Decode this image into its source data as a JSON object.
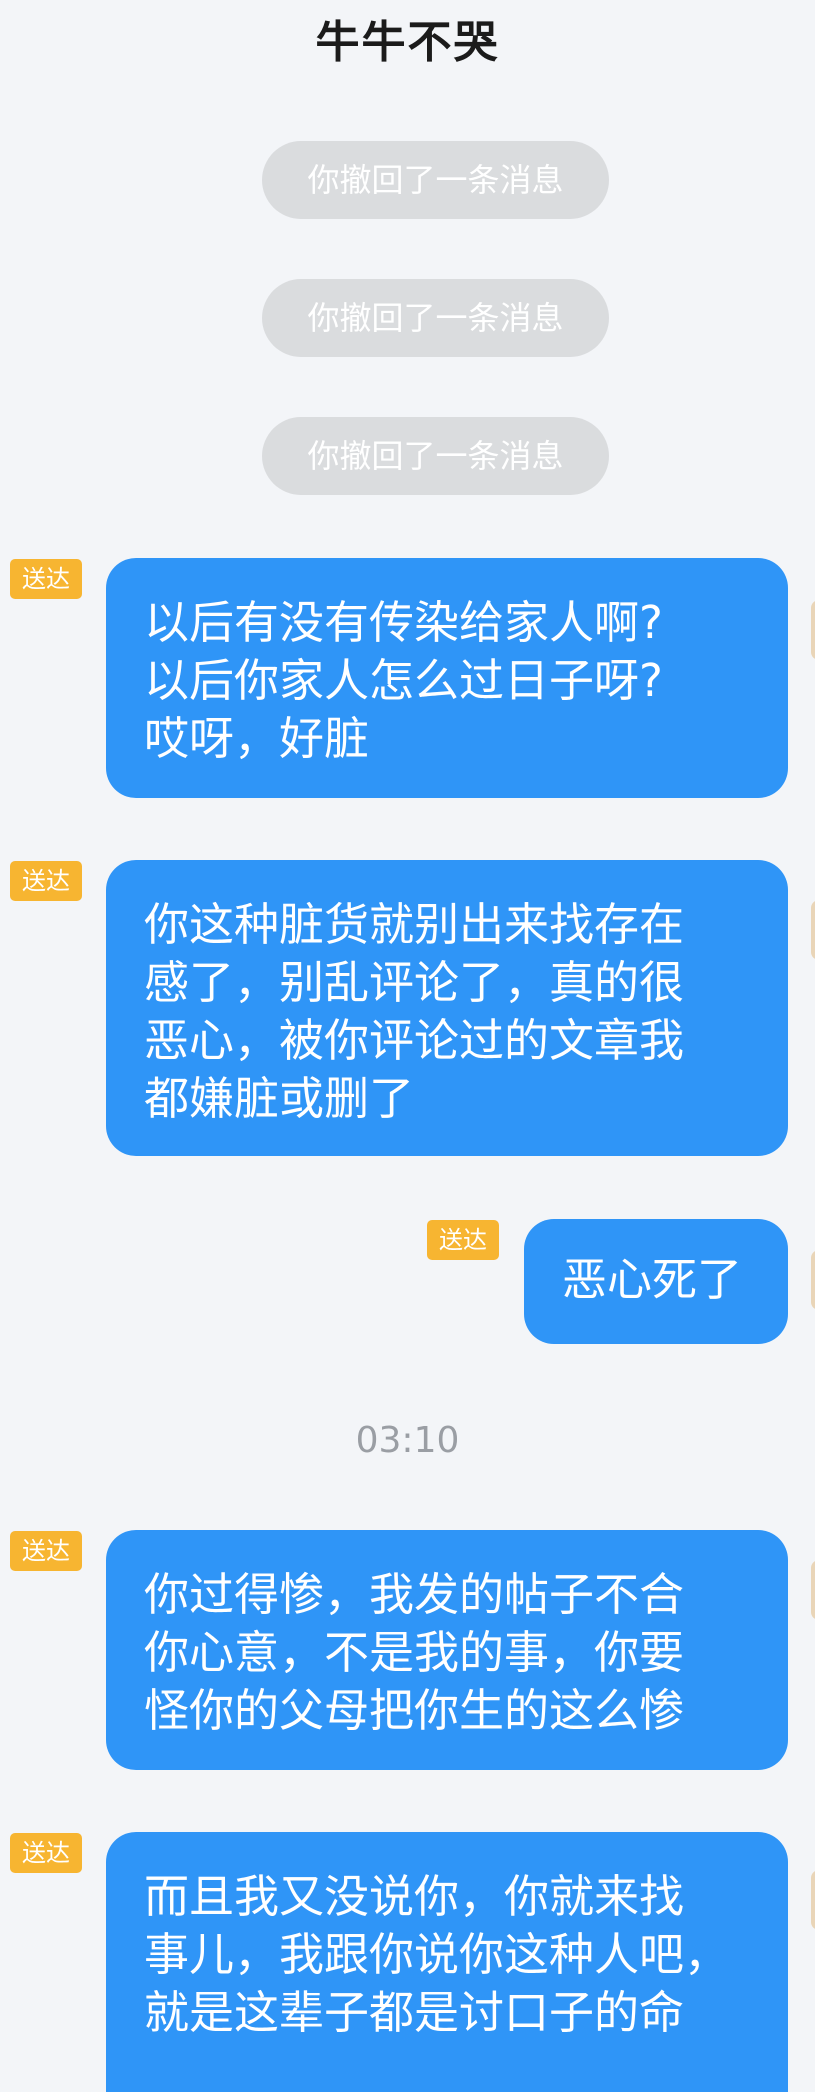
{
  "header": {
    "title": "牛牛不哭"
  },
  "recall_notices": [
    {
      "text": "你撤回了一条消息"
    },
    {
      "text": "你撤回了一条消息"
    },
    {
      "text": "你撤回了一条消息"
    }
  ],
  "messages": [
    {
      "status": "送达",
      "text": "以后有没有传染给家人啊?\n以后你家人怎么过日子呀?\n哎呀，好脏"
    },
    {
      "status": "送达",
      "text": "你这种脏货就别出来找存在\n感了，别乱评论了，真的很\n恶心，被你评论过的文章我\n都嫌脏或删了"
    },
    {
      "status": "送达",
      "text": "恶心死了"
    },
    {
      "status": "送达",
      "text": "你过得惨，我发的帖子不合\n你心意，不是我的事，你要\n怪你的父母把你生的这么惨"
    },
    {
      "status": "送达",
      "text": "而且我又没说你，你就来找\n事儿，我跟你说你这种人吧，\n就是这辈子都是讨口子的命"
    }
  ],
  "timestamp": "03:10",
  "colors": {
    "bubble": "#2f95f7",
    "delivered_badge": "#f7b531",
    "recall_pill": "#dadcde",
    "background": "#f3f5f8"
  }
}
